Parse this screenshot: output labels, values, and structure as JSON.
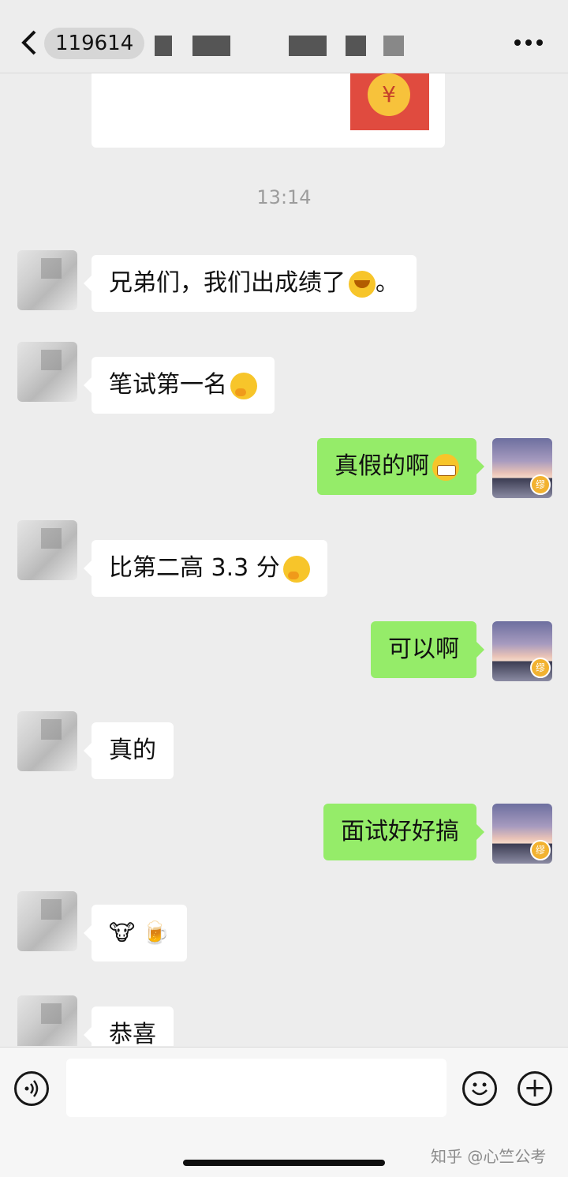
{
  "header": {
    "chat_title": "119614"
  },
  "time_separator": "13:14",
  "red_packet": {
    "symbol": "¥"
  },
  "messages": [
    {
      "side": "left",
      "text": "兄弟们，我们出成绩了",
      "emoji": "laugh-cry",
      "tail": "。"
    },
    {
      "side": "left",
      "text": "笔试第一名",
      "emoji": "thinking"
    },
    {
      "side": "right",
      "text": "真假的啊",
      "emoji": "grin"
    },
    {
      "side": "left",
      "text": "比第二高 3.3 分",
      "emoji": "thinking"
    },
    {
      "side": "right",
      "text": "可以啊"
    },
    {
      "side": "left",
      "text": "真的"
    },
    {
      "side": "right",
      "text": "面试好好搞"
    },
    {
      "side": "left",
      "text": "🐮 🍺"
    },
    {
      "side": "left",
      "text": "恭喜"
    }
  ],
  "self_avatar_badge": "缪",
  "footer": {
    "watermark": "知乎 @心竺公考"
  },
  "icons": [
    "back-arrow-icon",
    "more-icon",
    "voice-icon",
    "emoji-face-icon",
    "plus-icon"
  ],
  "colors": {
    "sent_bubble": "#95ec69",
    "received_bubble": "#ffffff",
    "background": "#ededed"
  }
}
